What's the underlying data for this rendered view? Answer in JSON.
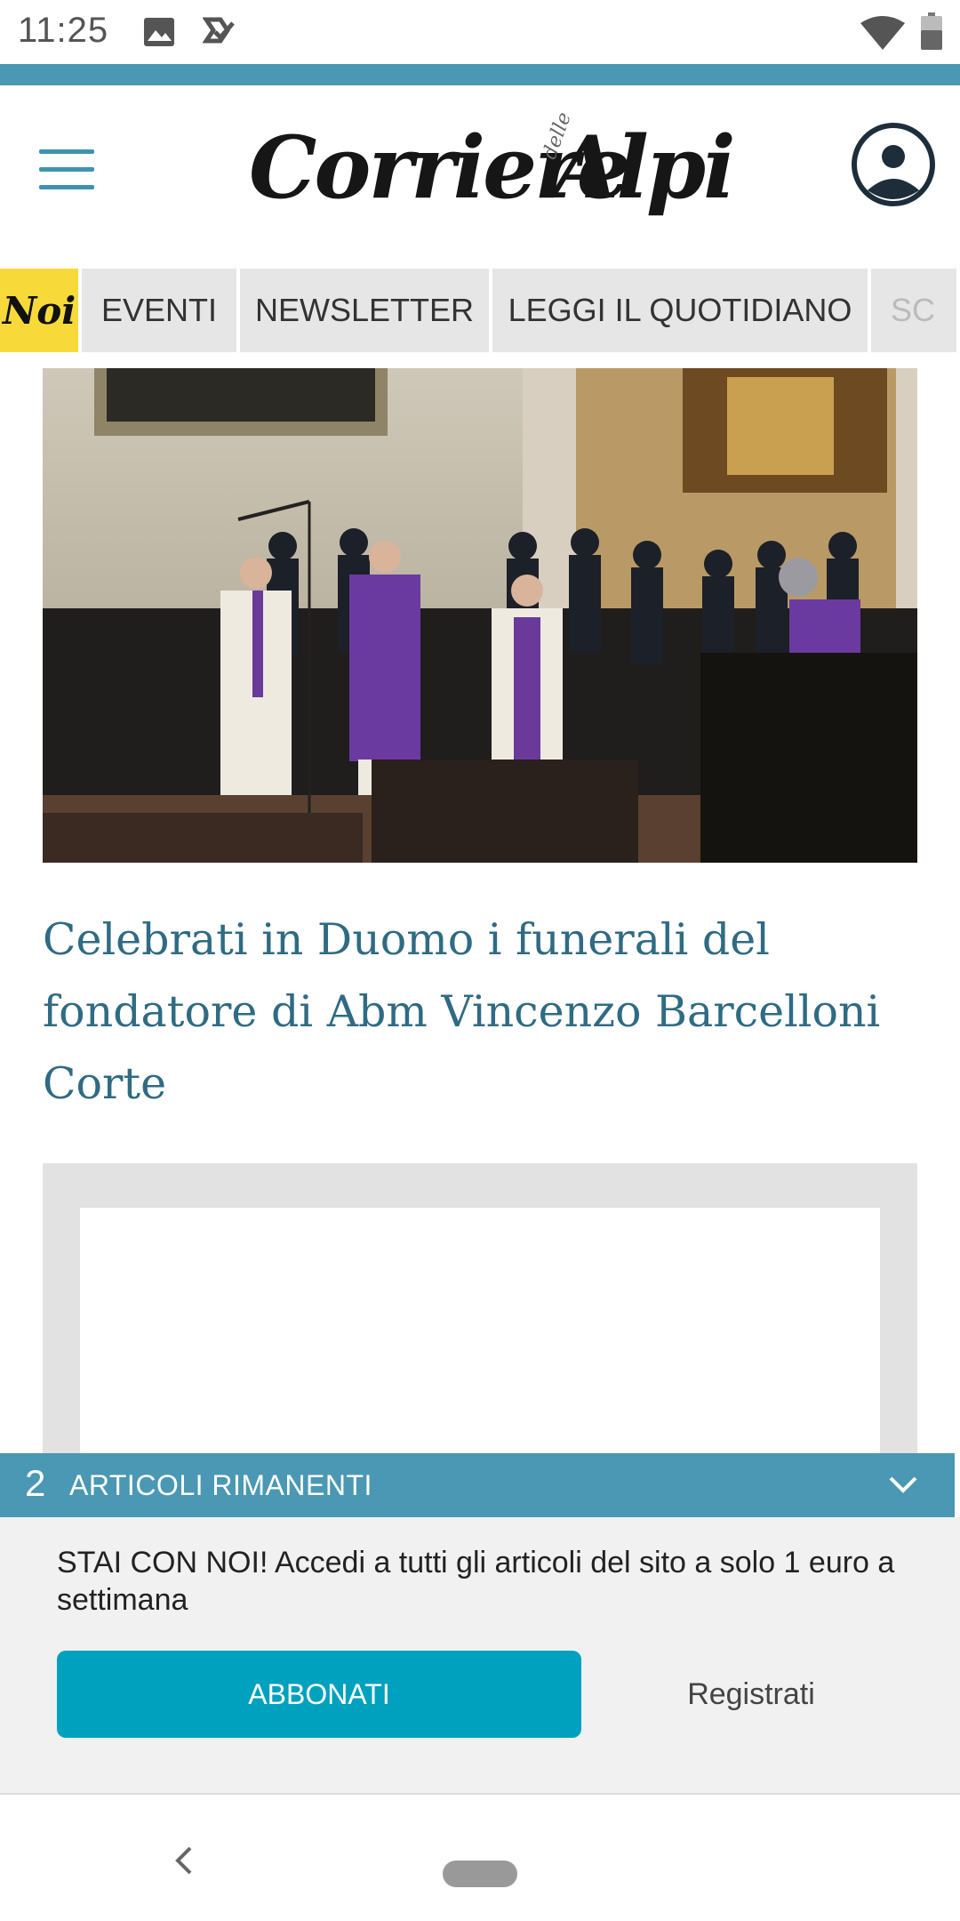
{
  "status_bar": {
    "time": "11:25",
    "icons": [
      "gallery-icon",
      "tasks-icon",
      "wifi-icon",
      "battery-icon"
    ]
  },
  "header": {
    "logo": {
      "main": "Corriere",
      "small": "delle",
      "tail": "Alpi"
    },
    "menu_icon": "hamburger-menu-icon",
    "account_icon": "account-icon"
  },
  "nav_tabs": [
    {
      "label": "Noi"
    },
    {
      "label": "EVENTI"
    },
    {
      "label": "NEWSLETTER"
    },
    {
      "label": "LEGGI IL QUOTIDIANO"
    },
    {
      "label": "SC"
    }
  ],
  "article": {
    "headline": "Celebrati in Duomo i funerali del fondatore di Abm Vincenzo Barcelloni Corte"
  },
  "paywall": {
    "count": "2",
    "bar_text": "ARTICOLI RIMANENTI",
    "message": "STAI CON NOI! Accedi a tutti gli articoli del sito a solo 1 euro a settimana",
    "subscribe_label": "ABBONATI",
    "register_label": "Registrati"
  },
  "colors": {
    "accent_teal": "#4a98b3",
    "button_teal": "#00a1bf",
    "headline_blue": "#2f6b83",
    "noi_yellow": "#f7d93a"
  }
}
